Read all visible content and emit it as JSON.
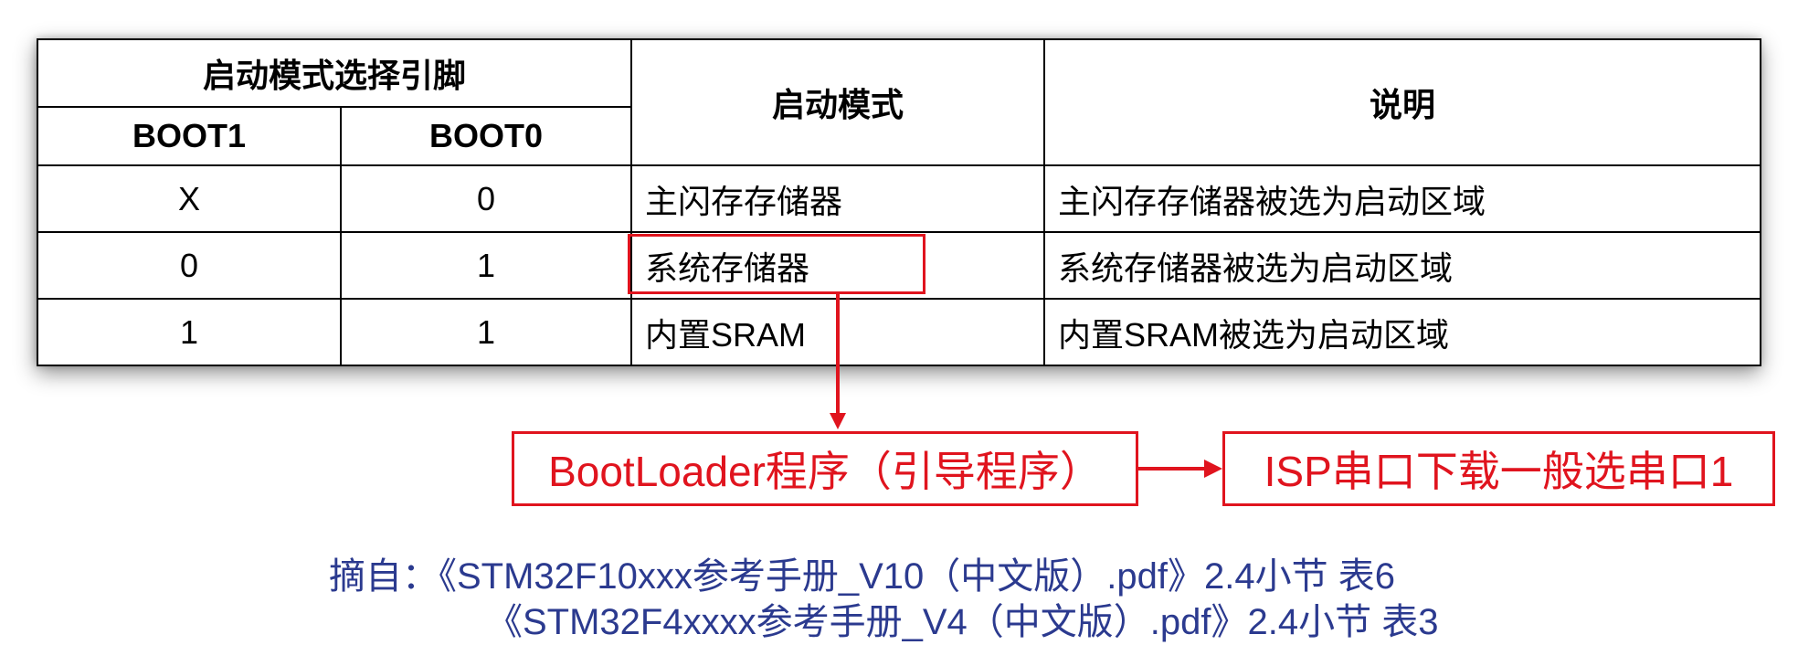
{
  "table": {
    "header": {
      "pins_group": "启动模式选择引脚",
      "boot1": "BOOT1",
      "boot0": "BOOT0",
      "mode": "启动模式",
      "desc": "说明"
    },
    "rows": [
      {
        "boot1": "X",
        "boot0": "0",
        "mode": "主闪存存储器",
        "desc": "主闪存存储器被选为启动区域"
      },
      {
        "boot1": "0",
        "boot0": "1",
        "mode": "系统存储器",
        "desc": "系统存储器被选为启动区域"
      },
      {
        "boot1": "1",
        "boot0": "1",
        "mode": "内置SRAM",
        "desc": "内置SRAM被选为启动区域"
      }
    ]
  },
  "annotations": {
    "bootloader": "BootLoader程序（引导程序）",
    "isp": "ISP串口下载一般选串口1",
    "accent_color": "#e0141e"
  },
  "source": {
    "line1": "摘自：《STM32F10xxx参考手册_V10（中文版）.pdf》2.4小节 表6",
    "line2": "《STM32F4xxxx参考手册_V4（中文版）.pdf》2.4小节 表3",
    "color": "#2b3a8f"
  }
}
